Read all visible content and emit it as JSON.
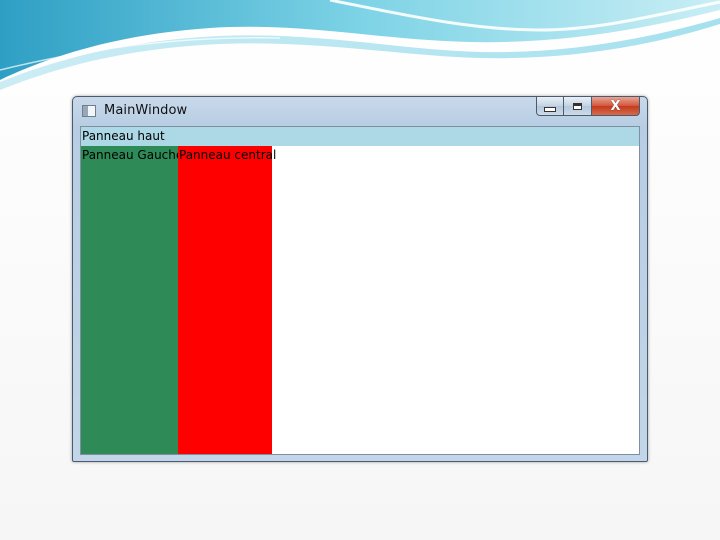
{
  "window": {
    "title": "MainWindow",
    "close_glyph": "X"
  },
  "panels": {
    "top": {
      "label": "Panneau haut",
      "color": "#add8e6"
    },
    "left": {
      "label": "Panneau Gauche",
      "color": "#2e8b57"
    },
    "center": {
      "label": "Panneau central",
      "color": "#ff0000"
    }
  }
}
